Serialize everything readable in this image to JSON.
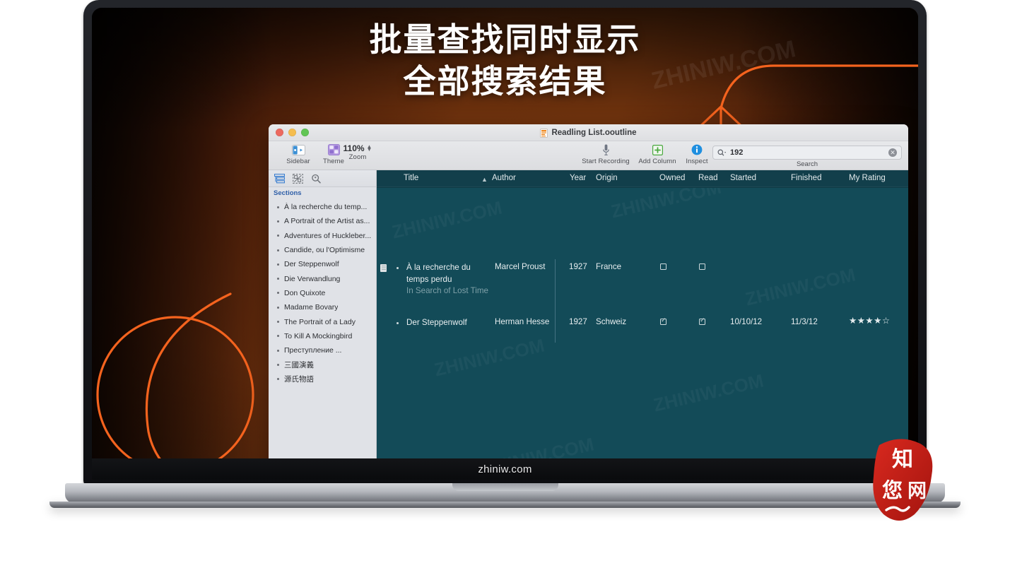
{
  "promo": {
    "headline_line1": "批量查找同时显示",
    "headline_line2": "全部搜索结果",
    "bezel_logo": "zhiniw.com",
    "watermark_text": "ZHINIW.COM",
    "seal_chars": [
      "知",
      "网",
      "您"
    ],
    "accent_color": "#f4631e",
    "wallpaper_color": "#78360f"
  },
  "window": {
    "title": "Readling List.ooutline",
    "doc_icon": "outline-document-icon",
    "traffic_lights": [
      "close-button",
      "minimize-button",
      "zoom-button"
    ]
  },
  "toolbar": {
    "items": [
      {
        "label": "Sidebar",
        "icon": "sidebar-icon"
      },
      {
        "label": "Theme",
        "icon": "theme-icon"
      },
      {
        "label": "Start Recording",
        "icon": "microphone-icon"
      },
      {
        "label": "Add Column",
        "icon": "add-column-icon"
      },
      {
        "label": "Inspect",
        "icon": "info-circle-icon"
      }
    ],
    "zoom": {
      "value": "110%",
      "label": "Zoom"
    },
    "search": {
      "value": "192",
      "label": "Search",
      "icon": "search-magnifier-icon",
      "clear_icon": "clear-circle-icon"
    }
  },
  "sidebar": {
    "tool_icons": [
      "outline-structure-icon",
      "dashed-selection-icon",
      "search-magnifier-icon"
    ],
    "header": "Sections",
    "items": [
      {
        "label": "À la recherche du temp..."
      },
      {
        "label": "A Portrait of the Artist as..."
      },
      {
        "label": "Adventures of Huckleber..."
      },
      {
        "label": "Candide, ou l'Optimisme"
      },
      {
        "label": "Der Steppenwolf"
      },
      {
        "label": "Die Verwandlung"
      },
      {
        "label": "Don Quixote"
      },
      {
        "label": "Madame Bovary"
      },
      {
        "label": "The Portrait of a Lady"
      },
      {
        "label": "To Kill A Mockingbird"
      },
      {
        "label": "Преступление ..."
      },
      {
        "label": "三國演義"
      },
      {
        "label": "源氏物語"
      }
    ]
  },
  "outline": {
    "columns": [
      {
        "key": "title",
        "label": "Title"
      },
      {
        "key": "author",
        "label": "Author",
        "sorted": "ascending"
      },
      {
        "key": "year",
        "label": "Year"
      },
      {
        "key": "origin",
        "label": "Origin"
      },
      {
        "key": "owned",
        "label": "Owned"
      },
      {
        "key": "read",
        "label": "Read"
      },
      {
        "key": "started",
        "label": "Started"
      },
      {
        "key": "finished",
        "label": "Finished"
      },
      {
        "key": "rating",
        "label": "My Rating"
      }
    ],
    "rows": [
      {
        "title": "À la recherche du temps perdu",
        "subtitle": "In Search of Lost Time",
        "author": "Marcel Proust",
        "year": "1927",
        "origin": "France",
        "owned": false,
        "read": false,
        "started": "",
        "finished": "",
        "rating_filled": 0,
        "rating_empty": 0,
        "has_note": true
      },
      {
        "title": "Der Steppenwolf",
        "subtitle": "",
        "author": "Herman Hesse",
        "year": "1927",
        "origin": "Schweiz",
        "owned": true,
        "read": true,
        "started": "10/10/12",
        "finished": "11/3/12",
        "rating_filled": 4,
        "rating_empty": 1,
        "has_note": false
      }
    ]
  }
}
